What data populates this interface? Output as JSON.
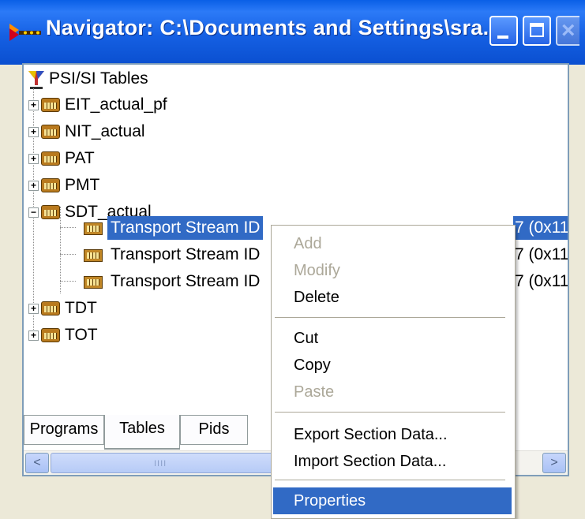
{
  "window": {
    "title": "Navigator: C:\\Documents and Settings\\sra...",
    "buttons": {
      "minimize": "minimize-icon",
      "maximize": "maximize-icon",
      "close": "close-icon"
    }
  },
  "tree": {
    "root_label": "PSI/SI Tables",
    "nodes": [
      {
        "label": "EIT_actual_pf",
        "expander": "+"
      },
      {
        "label": "NIT_actual",
        "expander": "+"
      },
      {
        "label": "PAT",
        "expander": "+"
      },
      {
        "label": "PMT",
        "expander": "+"
      },
      {
        "label": "SDT_actual",
        "expander": "−"
      },
      {
        "label": "Transport Stream ID",
        "suffix": "7 (0x11"
      },
      {
        "label": "Transport Stream ID",
        "suffix": "7 (0x11"
      },
      {
        "label": "Transport Stream ID",
        "suffix": "7 (0x11"
      },
      {
        "label": "TDT",
        "expander": "+"
      },
      {
        "label": "TOT",
        "expander": "+"
      }
    ],
    "scroll_left": "<",
    "scroll_right": ">",
    "scroll_grip": "IIII"
  },
  "tabs": [
    "Programs",
    "Tables",
    "Pids"
  ],
  "context_menu": {
    "items": [
      {
        "label": "Add",
        "state": "disabled"
      },
      {
        "label": "Modify",
        "state": "disabled"
      },
      {
        "label": "Delete",
        "state": "enabled"
      },
      {
        "label": "Cut",
        "state": "enabled"
      },
      {
        "label": "Copy",
        "state": "enabled"
      },
      {
        "label": "Paste",
        "state": "disabled"
      },
      {
        "label": "Export Section Data...",
        "state": "enabled"
      },
      {
        "label": "Import Section Data...",
        "state": "enabled"
      },
      {
        "label": "Properties",
        "state": "highlighted"
      }
    ]
  },
  "colors": {
    "selection": "#316ac5",
    "titlebar": "#0a5fe6",
    "face": "#ece9d8"
  }
}
